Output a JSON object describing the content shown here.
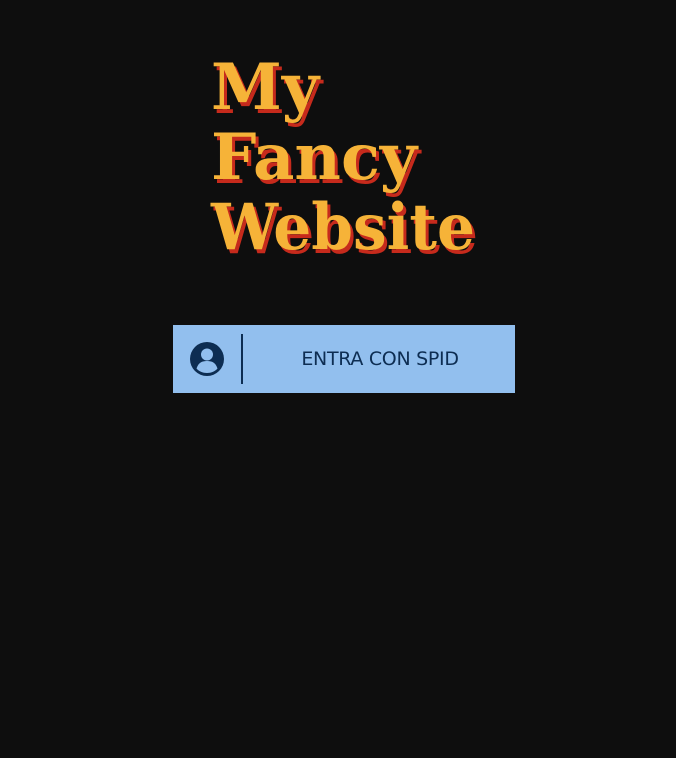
{
  "logo": {
    "line1": "My",
    "line2": "Fancy",
    "line3": "Website",
    "fill_color": "#f6b338",
    "shadow_color": "#c62a1c"
  },
  "login": {
    "button_label": "ENTRA CON SPID",
    "button_bg": "#92bfee",
    "text_color": "#0d2d52",
    "icon": "user-circle-icon"
  },
  "page": {
    "background": "#0e0e0e"
  }
}
